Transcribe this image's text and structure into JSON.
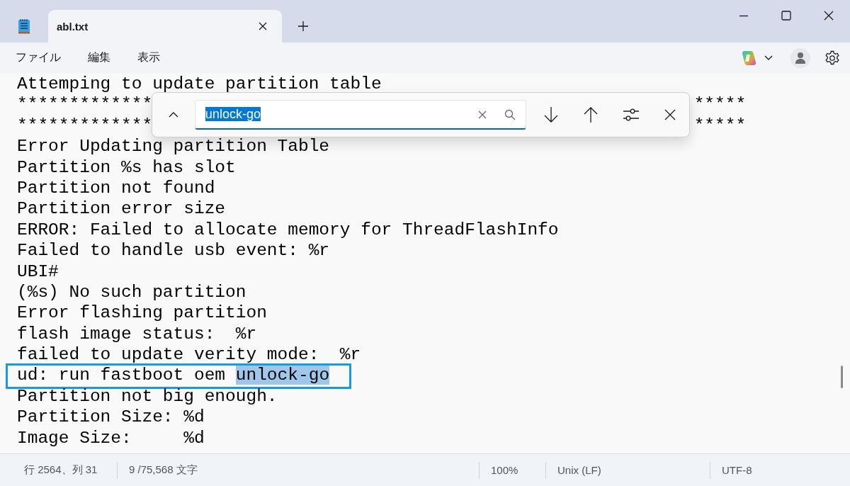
{
  "window": {
    "tab": {
      "title": "abl.txt",
      "selected": true
    }
  },
  "menu": [
    "ファイル",
    "編集",
    "表示"
  ],
  "find": {
    "value": "unlock-go",
    "value_selected": true
  },
  "editor": {
    "lines": [
      {
        "kind": "plain",
        "text": "Attemping to update partition table",
        "boxed": false
      },
      {
        "kind": "split",
        "left": "*************",
        "right": "*****",
        "boxed": false
      },
      {
        "kind": "split",
        "left": "*************",
        "right": "*****",
        "boxed": false
      },
      {
        "kind": "plain",
        "text": "Error Updating partition Table",
        "boxed": false
      },
      {
        "kind": "plain",
        "text": "Partition %s has slot",
        "boxed": false
      },
      {
        "kind": "plain",
        "text": "Partition not found",
        "boxed": false
      },
      {
        "kind": "plain",
        "text": "Partition error size",
        "boxed": false
      },
      {
        "kind": "plain",
        "text": "ERROR: Failed to allocate memory for ThreadFlashInfo",
        "boxed": false
      },
      {
        "kind": "plain",
        "text": "Failed to handle usb event: %r",
        "boxed": false
      },
      {
        "kind": "plain",
        "text": "UBI#",
        "boxed": false
      },
      {
        "kind": "plain",
        "text": "(%s) No such partition",
        "boxed": false
      },
      {
        "kind": "plain",
        "text": "Error flashing partition",
        "boxed": false
      },
      {
        "kind": "plain",
        "text": "flash image status:  %r",
        "boxed": false
      },
      {
        "kind": "plain",
        "text": "failed to update verity mode:  %r",
        "boxed": false
      },
      {
        "kind": "plain",
        "text": "ud: run fastboot oem ",
        "match": "unlock-go",
        "boxed": true
      },
      {
        "kind": "plain",
        "text": "Partition not big enough.",
        "boxed": false
      },
      {
        "kind": "plain",
        "text": "Partition Size: %d",
        "boxed": false
      },
      {
        "kind": "plain",
        "text": "Image Size:     %d",
        "boxed": false
      }
    ]
  },
  "status_bar": [
    "行 2564、列 31",
    "9 /75,568 文字",
    "100%",
    "Unix (LF)",
    "UTF-8"
  ]
}
